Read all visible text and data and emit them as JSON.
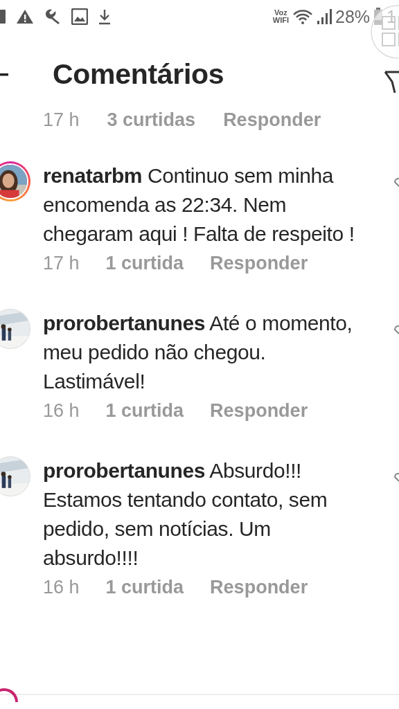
{
  "status_bar": {
    "voz": "Voz",
    "wifi_label": "WIFI",
    "battery": "28%",
    "clock": "1"
  },
  "header": {
    "title": "Comentários"
  },
  "previous_meta": {
    "time": "17 h",
    "likes": "3 curtidas",
    "reply": "Responder"
  },
  "comments": [
    {
      "username": "renatarbm",
      "text": "Continuo sem minha encomenda as 22:34. Nem chegaram aqui ! Falta de respeito !",
      "story_ring": true,
      "kind": "picture",
      "time": "17 h",
      "likes": "1 curtida",
      "reply": "Responder"
    },
    {
      "username": "prorobertanunes",
      "text": "Até o momento, meu pedido não chegou. Lastimável!",
      "story_ring": false,
      "kind": "picture",
      "time": "16 h",
      "likes": "1 curtida",
      "reply": "Responder"
    },
    {
      "username": "prorobertanunes",
      "text": "Absurdo!!! Estamos tentando contato, sem pedido, sem notícias. Um absurdo!!!!",
      "story_ring": false,
      "kind": "picture",
      "time": "16 h",
      "likes": "1 curtida",
      "reply": "Responder"
    }
  ],
  "bottom_avatar": {
    "story_ring": true
  }
}
